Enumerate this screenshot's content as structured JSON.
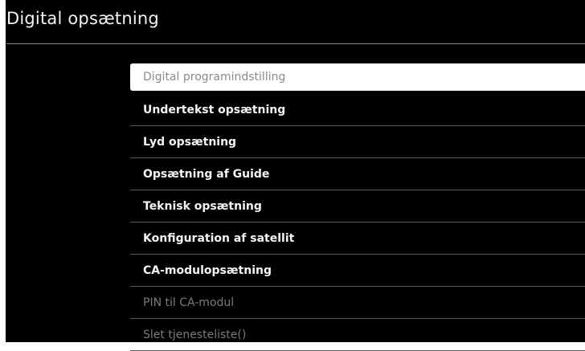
{
  "header": {
    "title": "Digital opsætning"
  },
  "menu": {
    "items": [
      {
        "label": "Digital programindstilling",
        "state": "selected"
      },
      {
        "label": "Undertekst opsætning",
        "state": "enabled"
      },
      {
        "label": "Lyd opsætning",
        "state": "enabled"
      },
      {
        "label": "Opsætning af Guide",
        "state": "enabled"
      },
      {
        "label": "Teknisk opsætning",
        "state": "enabled"
      },
      {
        "label": "Konfiguration af satellit",
        "state": "enabled"
      },
      {
        "label": "CA-modulopsætning",
        "state": "enabled"
      },
      {
        "label": "PIN til CA-modul",
        "state": "disabled"
      },
      {
        "label": "Slet tjenesteliste()",
        "state": "disabled"
      }
    ]
  },
  "colors": {
    "background": "#000000",
    "text": "#f4f4f4",
    "selected_background": "#ffffff",
    "selected_text": "#8a8a8a",
    "disabled_text": "#7a7a7a"
  }
}
